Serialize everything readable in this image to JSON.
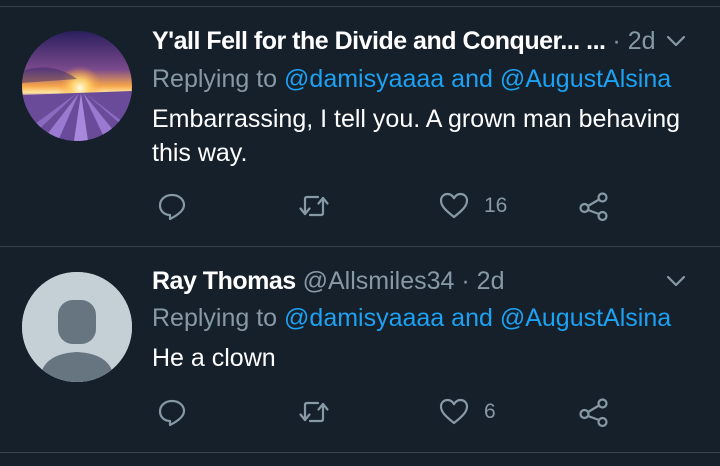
{
  "colors": {
    "background": "#15202b",
    "muted": "#8899a6",
    "mention": "#1da1f2",
    "divider": "#38444d"
  },
  "tweets": [
    {
      "name": "Y'all Fell for the Divide and Conquer... ...",
      "handle": "",
      "dot": "·",
      "time": "2d",
      "replying_prefix": "Replying to",
      "mention1": "@damisyaaaa",
      "and": "and",
      "mention2": "@AugustAlsina",
      "text": "Embarrassing, I tell you.  A grown man behaving this way.",
      "reply_count": "",
      "retweet_count": "",
      "like_count": "16",
      "avatar": "lavender-field-sunset"
    },
    {
      "name": "Ray Thomas",
      "handle": "@Allsmiles34",
      "dot": "·",
      "time": "2d",
      "replying_prefix": "Replying to",
      "mention1": "@damisyaaaa",
      "and": "and",
      "mention2": "@AugustAlsina",
      "text": "He a clown",
      "reply_count": "",
      "retweet_count": "",
      "like_count": "6",
      "avatar": "default-profile"
    }
  ],
  "icons": [
    "chevron-down-icon",
    "reply-icon",
    "retweet-icon",
    "like-icon",
    "share-icon"
  ]
}
